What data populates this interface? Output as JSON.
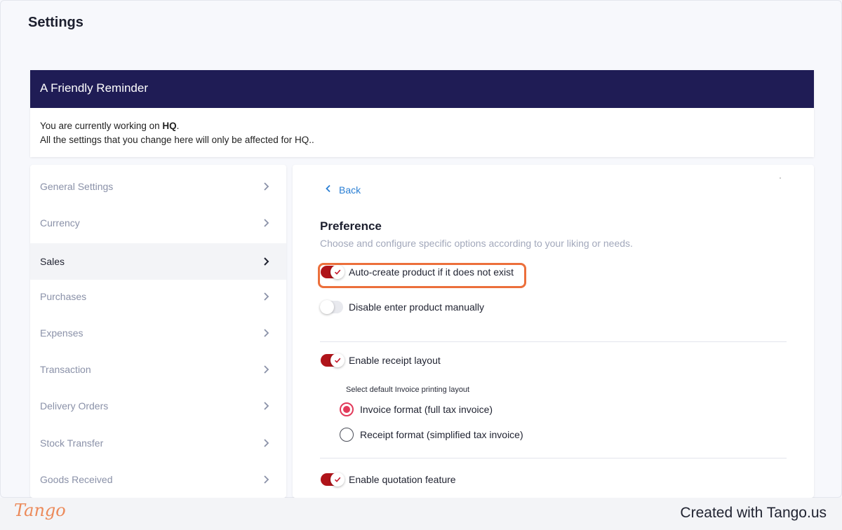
{
  "page": {
    "title": "Settings"
  },
  "reminder": {
    "title": "A Friendly Reminder",
    "line1_prefix": "You are currently working on ",
    "line1_bold": "HQ",
    "line1_suffix": ".",
    "line2": "All the settings that you change here will only be affected for HQ.."
  },
  "sidebar": {
    "items": [
      {
        "label": "General Settings",
        "active": false
      },
      {
        "label": "Currency",
        "active": false
      },
      {
        "label": "Sales",
        "active": true
      },
      {
        "label": "Purchases",
        "active": false
      },
      {
        "label": "Expenses",
        "active": false
      },
      {
        "label": "Transaction",
        "active": false
      },
      {
        "label": "Delivery Orders",
        "active": false
      },
      {
        "label": "Stock Transfer",
        "active": false
      },
      {
        "label": "Goods Received",
        "active": false
      }
    ]
  },
  "panel": {
    "back_label": "Back",
    "title": "Preference",
    "subtitle": "Choose and configure specific options according to your liking or needs.",
    "toggles": {
      "auto_create": {
        "label": "Auto-create product if it does not exist",
        "on": true
      },
      "disable_manual": {
        "label": "Disable enter product manually",
        "on": false
      },
      "receipt_layout": {
        "label": "Enable receipt layout",
        "on": true
      },
      "quotation": {
        "label": "Enable quotation feature",
        "on": true
      }
    },
    "layout_label": "Select default Invoice printing layout",
    "radios": {
      "invoice": {
        "label": "Invoice format (full tax invoice)",
        "selected": true
      },
      "receipt": {
        "label": "Receipt format (simplified tax invoice)",
        "selected": false
      }
    }
  },
  "footer": {
    "logo": "Tango",
    "created": "Created with Tango.us"
  },
  "colors": {
    "header": "#1f1c55",
    "toggle_on": "#b0141a",
    "highlight": "#ec6f3b",
    "link": "#2a7fd4",
    "radio": "#e23a5a"
  }
}
